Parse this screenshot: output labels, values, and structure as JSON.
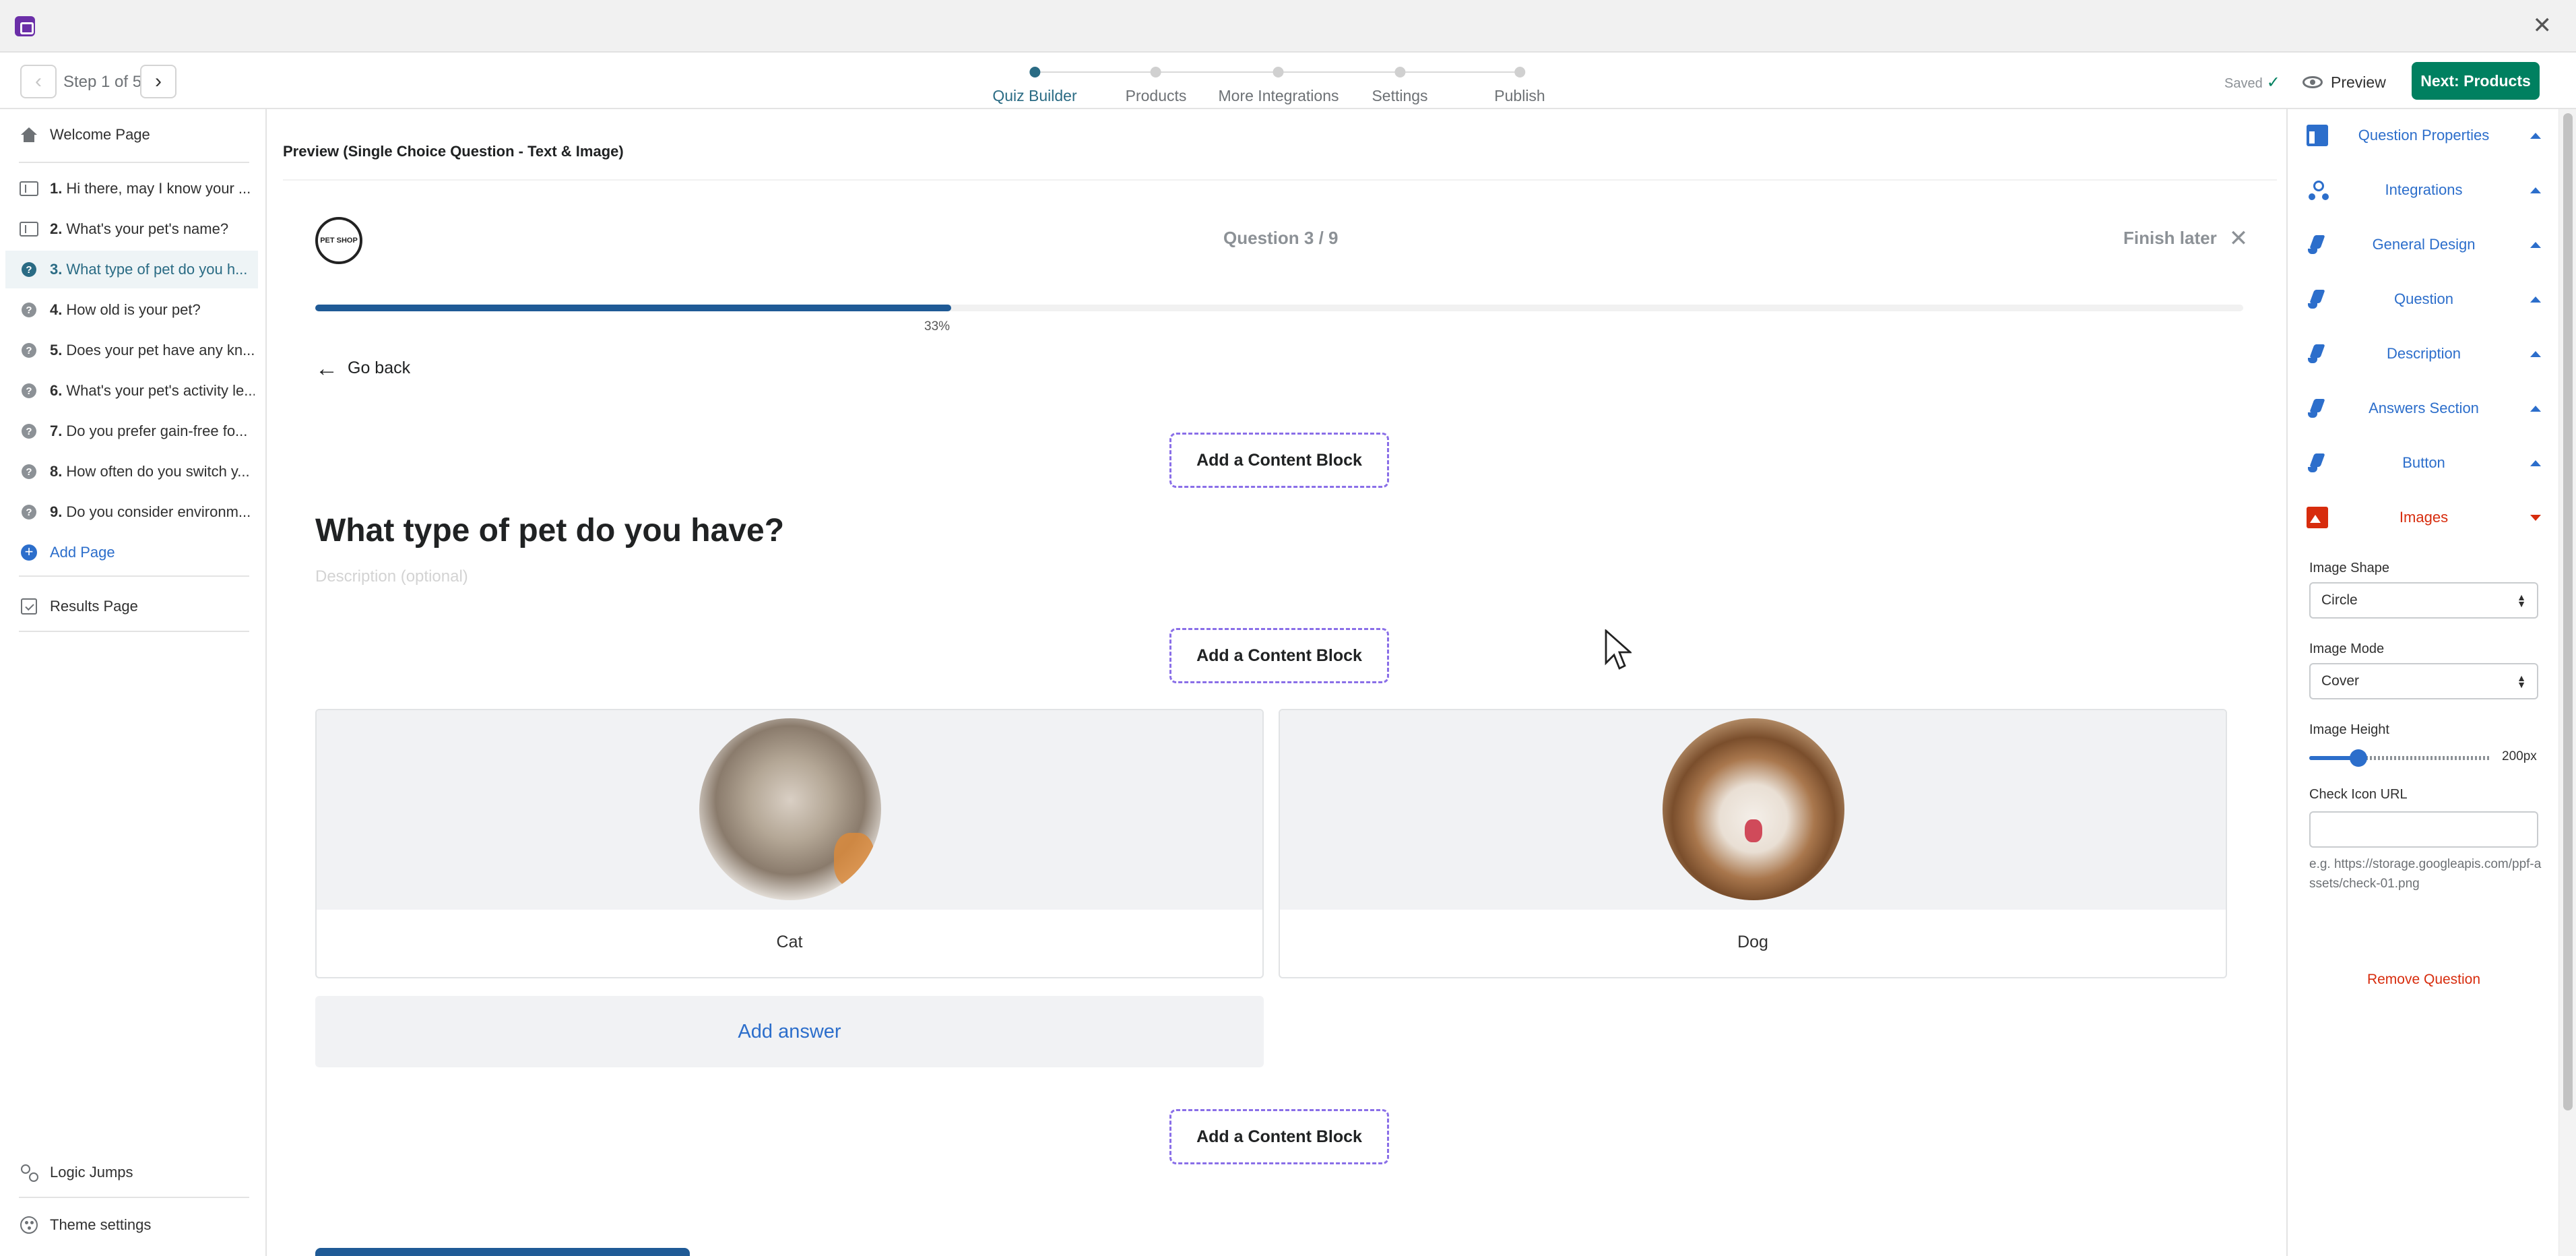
{
  "window": {
    "close_glyph": "✕"
  },
  "topbar": {
    "step_label": "Step 1 of 5",
    "steps": [
      {
        "label": "Quiz Builder",
        "active": true
      },
      {
        "label": "Products",
        "active": false
      },
      {
        "label": "More Integrations",
        "active": false
      },
      {
        "label": "Settings",
        "active": false
      },
      {
        "label": "Publish",
        "active": false
      }
    ],
    "saved_label": "Saved",
    "preview_label": "Preview",
    "next_label": "Next: Products"
  },
  "sidebar": {
    "welcome": "Welcome Page",
    "items": [
      {
        "num": "1.",
        "text": "Hi there, may I know your ..."
      },
      {
        "num": "2.",
        "text": "What's your pet's name?"
      },
      {
        "num": "3.",
        "text": "What type of pet do you h..."
      },
      {
        "num": "4.",
        "text": "How old is your pet?"
      },
      {
        "num": "5.",
        "text": "Does your pet have any kn..."
      },
      {
        "num": "6.",
        "text": "What's your pet's activity le..."
      },
      {
        "num": "7.",
        "text": "Do you prefer gain-free fo..."
      },
      {
        "num": "8.",
        "text": "How often do you switch y..."
      },
      {
        "num": "9.",
        "text": "Do you consider environm..."
      }
    ],
    "add_page": "Add Page",
    "results": "Results Page",
    "logic_jumps": "Logic Jumps",
    "theme_settings": "Theme settings"
  },
  "main": {
    "preview_title": "Preview (Single Choice Question - Text & Image)",
    "logo_text": "PET SHOP",
    "question_count": "Question 3 / 9",
    "finish_later": "Finish later",
    "progress": {
      "value": 0.33,
      "label": "33%"
    },
    "go_back": "Go back",
    "add_block": "Add a Content Block",
    "question_title": "What type of pet do you have?",
    "description_placeholder": "Description (optional)",
    "answers": [
      {
        "label": "Cat"
      },
      {
        "label": "Dog"
      }
    ],
    "add_answer": "Add answer"
  },
  "right_panel": {
    "sections": [
      {
        "label": "Question Properties",
        "icon": "layout-icon"
      },
      {
        "label": "Integrations",
        "icon": "integrations-icon"
      },
      {
        "label": "General Design",
        "icon": "brush-icon"
      },
      {
        "label": "Question",
        "icon": "brush-icon"
      },
      {
        "label": "Description",
        "icon": "brush-icon"
      },
      {
        "label": "Answers Section",
        "icon": "brush-icon"
      },
      {
        "label": "Button",
        "icon": "brush-icon"
      },
      {
        "label": "Images",
        "icon": "image-icon",
        "open": true
      }
    ],
    "image_shape_label": "Image Shape",
    "image_shape_value": "Circle",
    "image_mode_label": "Image Mode",
    "image_mode_value": "Cover",
    "image_height_label": "Image Height",
    "image_height_value": "200px",
    "image_height_fraction": 0.27,
    "check_icon_label": "Check Icon URL",
    "check_icon_help": "e.g. https://storage.googleapis.com/ppf-assets/check-01.png",
    "remove_question": "Remove Question"
  },
  "colors": {
    "accent": "#2a6b84",
    "primary_button": "#008060",
    "link": "#2c6ecb",
    "danger": "#d72c0d",
    "progress": "#1f5a96",
    "dashed_border": "#8a6fe8"
  }
}
